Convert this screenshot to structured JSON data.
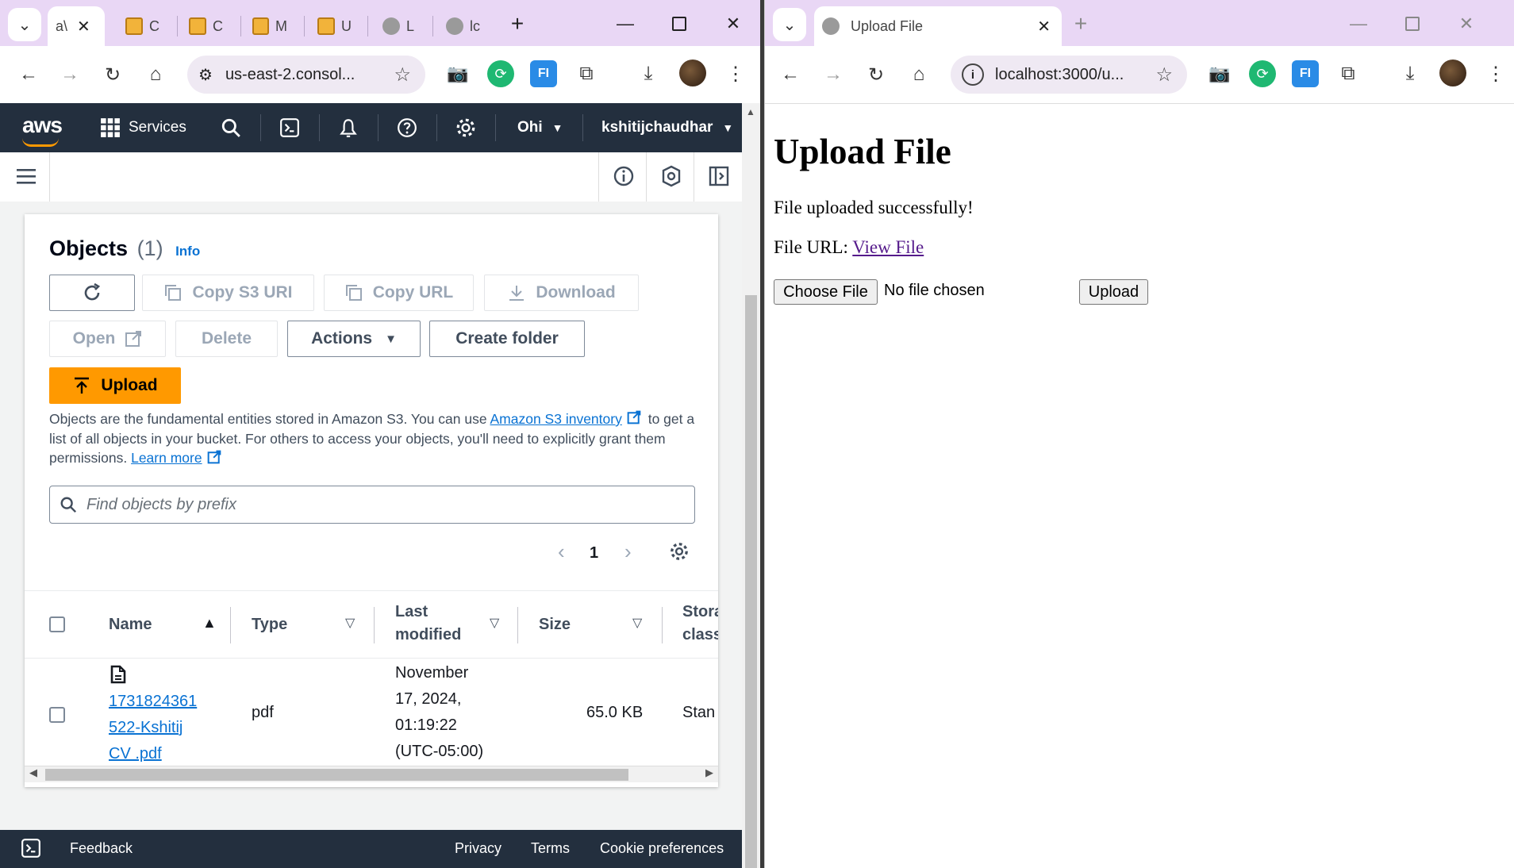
{
  "left_browser": {
    "tabs": [
      {
        "label": "a\\",
        "active": true
      },
      {
        "label": "C"
      },
      {
        "label": "C"
      },
      {
        "label": "M"
      },
      {
        "label": "U"
      },
      {
        "label": "L"
      },
      {
        "label": "lc"
      }
    ],
    "address": "us-east-2.consol..."
  },
  "aws": {
    "logo": "aws",
    "services_label": "Services",
    "region": "Ohi",
    "user": "kshitijchaudhar"
  },
  "objects": {
    "title": "Objects",
    "count": "(1)",
    "info": "Info",
    "copy_s3_uri": "Copy S3 URI",
    "copy_url": "Copy URL",
    "download": "Download",
    "open": "Open",
    "delete": "Delete",
    "actions": "Actions",
    "create_folder": "Create folder",
    "upload": "Upload",
    "desc_1": "Objects are the fundamental entities stored in Amazon S3. You can use ",
    "desc_link_1": "Amazon S3 inventory",
    "desc_2": " to get a list of all objects in your bucket. For others to access your objects, you'll need to explicitly grant them permissions. ",
    "desc_link_2": "Learn more",
    "search_placeholder": "Find objects by prefix",
    "page_number": "1"
  },
  "table": {
    "columns": [
      "Name",
      "Type",
      "Last modified",
      "Size",
      "Storage class"
    ],
    "column_head_lines": {
      "last_modified_1": "Last",
      "last_modified_2": "modified",
      "storage_1": "Stora",
      "storage_2": "class"
    },
    "rows": [
      {
        "name_lines": [
          "1731824361",
          "522-Kshitij",
          "CV .pdf"
        ],
        "type": "pdf",
        "modified_lines": [
          "November",
          "17, 2024,",
          "01:19:22",
          "(UTC-05:00)"
        ],
        "size": "65.0 KB",
        "storage": "Stan"
      }
    ]
  },
  "aws_footer": {
    "feedback": "Feedback",
    "privacy": "Privacy",
    "terms": "Terms",
    "cookies": "Cookie preferences"
  },
  "right_browser": {
    "tab_title": "Upload File",
    "address": "localhost:3000/u...",
    "page": {
      "heading": "Upload File",
      "status": "File uploaded successfully!",
      "url_label": "File URL: ",
      "url_link": "View File",
      "choose_file": "Choose File",
      "no_file": "No file chosen",
      "upload_button": "Upload"
    }
  },
  "colors": {
    "chrome_tabstrip": "#e9d7f5",
    "aws_nav": "#232f3e",
    "aws_orange": "#ff9900",
    "aws_link": "#0972d3",
    "visited_link": "#551a8b"
  }
}
